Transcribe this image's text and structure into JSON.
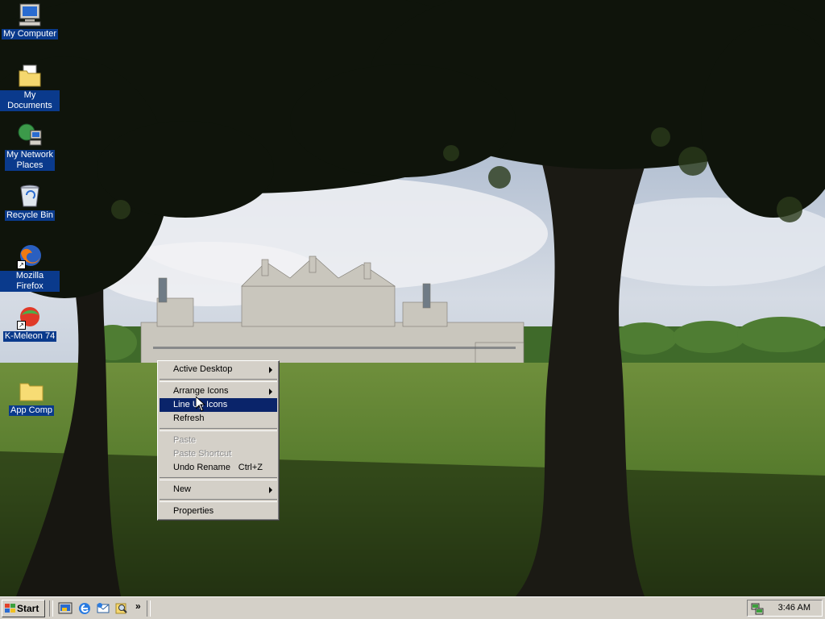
{
  "desktop": {
    "icons": [
      {
        "label": "My Computer",
        "icon": "my-computer-icon"
      },
      {
        "label": "My Documents",
        "icon": "my-documents-icon"
      },
      {
        "label_line1": "My Network",
        "label_line2": "Places",
        "icon": "network-places-icon"
      },
      {
        "label": "Recycle Bin",
        "icon": "recycle-bin-icon"
      },
      {
        "label": "Mozilla Firefox",
        "icon": "firefox-icon"
      },
      {
        "label": "K-Meleon 74",
        "icon": "k-meleon-icon"
      },
      {
        "label": "App Comp",
        "icon": "folder-icon"
      }
    ]
  },
  "context_menu": {
    "items": [
      {
        "label": "Active Desktop",
        "submenu": true
      },
      {
        "label": "Arrange Icons",
        "submenu": true
      },
      {
        "label": "Line Up Icons",
        "selected": true
      },
      {
        "label": "Refresh"
      },
      {
        "label": "Paste",
        "disabled": true
      },
      {
        "label": "Paste Shortcut",
        "disabled": true
      },
      {
        "label": "Undo Rename",
        "shortcut": "Ctrl+Z"
      },
      {
        "label": "New",
        "submenu": true
      },
      {
        "label": "Properties"
      }
    ]
  },
  "taskbar": {
    "start_label": "Start",
    "quick_launch_overflow": "»",
    "clock": "3:46 AM"
  },
  "colors": {
    "selection": "#0a246a",
    "face": "#d4d0c8",
    "icon_label_bg": "#0a3a8c"
  }
}
